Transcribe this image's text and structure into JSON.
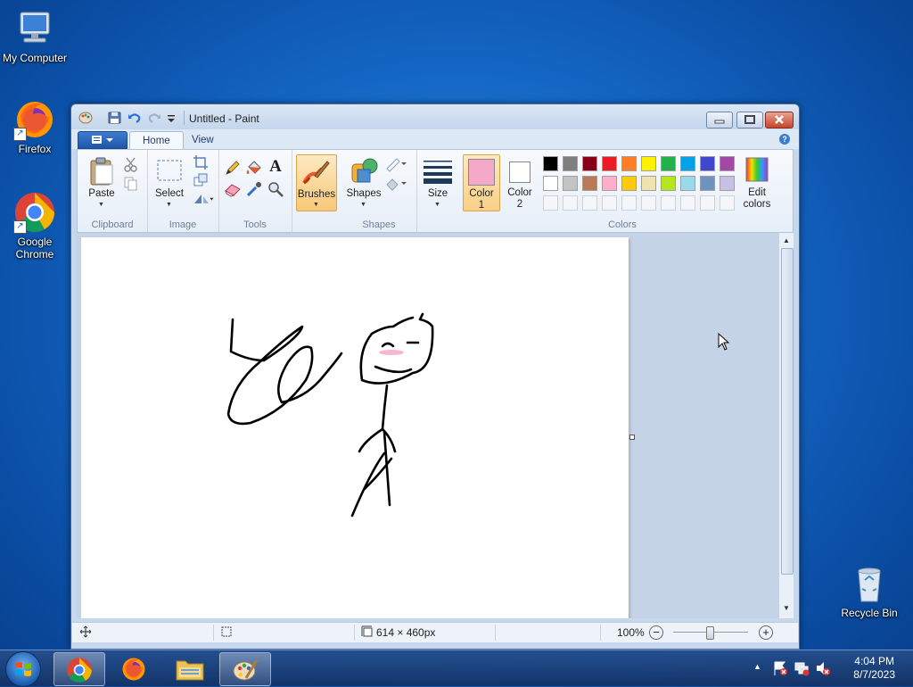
{
  "desktop": {
    "icons": [
      {
        "label": "My Computer"
      },
      {
        "label": "Firefox"
      },
      {
        "label": "Google Chrome"
      },
      {
        "label": "Recycle Bin"
      }
    ]
  },
  "window": {
    "title": "Untitled - Paint",
    "tabs": {
      "home": "Home",
      "view": "View"
    }
  },
  "ribbon": {
    "clipboard": {
      "paste": "Paste",
      "group": "Clipboard"
    },
    "image": {
      "select": "Select",
      "group": "Image"
    },
    "tools": {
      "group": "Tools",
      "text_tool": "A"
    },
    "brushes": {
      "label": "Brushes"
    },
    "shapes": {
      "label": "Shapes",
      "group": "Shapes"
    },
    "size": {
      "label": "Size"
    },
    "colors": {
      "color1_line1": "Color",
      "color1_line2": "1",
      "color2_line1": "Color",
      "color2_line2": "2",
      "edit_line1": "Edit",
      "edit_line2": "colors",
      "group": "Colors",
      "color1_value": "#f6a8c8",
      "color2_value": "#ffffff",
      "palette_row1": [
        "#000000",
        "#7f7f7f",
        "#880015",
        "#ed1c24",
        "#ff7f27",
        "#fff200",
        "#22b14c",
        "#00a2e8",
        "#3f48cc",
        "#a349a4"
      ],
      "palette_row2": [
        "#ffffff",
        "#c3c3c3",
        "#b97a57",
        "#ffaec9",
        "#ffc90e",
        "#efe4b0",
        "#b5e61d",
        "#99d9ea",
        "#7092be",
        "#c8bfe7"
      ]
    }
  },
  "statusbar": {
    "dimensions": "614 × 460px",
    "zoom": "100%"
  },
  "taskbar": {
    "time": "4:04 PM",
    "date": "8/7/2023"
  }
}
